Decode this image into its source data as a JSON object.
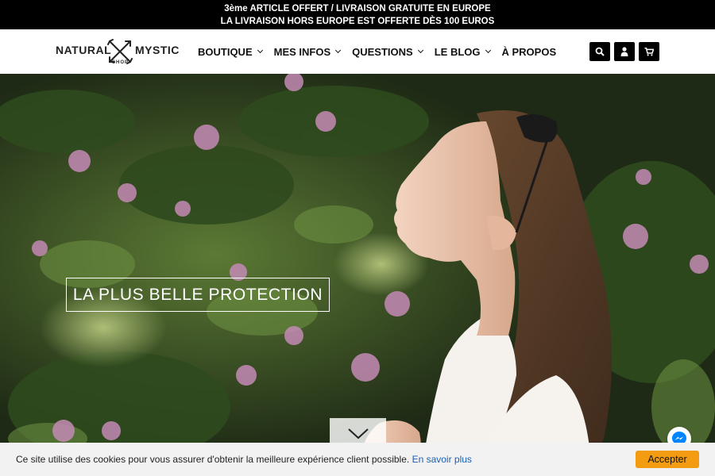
{
  "announcement": {
    "line1": "3ème ARTICLE OFFERT / LIVRAISON GRATUITE EN EUROPE",
    "line2": "LA LIVRAISON HORS EUROPE EST OFFERTE DÈS 100 EUROS"
  },
  "logo": {
    "word1": "NATURAL",
    "word2": "MYSTIC",
    "sub": "SHOP"
  },
  "nav": {
    "items": [
      {
        "label": "BOUTIQUE",
        "has_dropdown": true
      },
      {
        "label": "MES INFOS",
        "has_dropdown": true
      },
      {
        "label": "QUESTIONS",
        "has_dropdown": true
      },
      {
        "label": "LE BLOG",
        "has_dropdown": true
      },
      {
        "label": "À PROPOS",
        "has_dropdown": false
      }
    ]
  },
  "header_icons": [
    "search-icon",
    "user-icon",
    "cart-icon"
  ],
  "hero": {
    "caption": "LA PLUS BELLE PROTECTION",
    "scroll_icon": "chevron-down-icon"
  },
  "cookie": {
    "text": "Ce site utilise des cookies pour vous assurer d'obtenir la meilleure expérience client possible.",
    "link": "En savoir plus",
    "accept": "Accepter"
  },
  "colors": {
    "topbar_bg": "#000000",
    "accept_button": "#f39c12",
    "link": "#1a5fb4",
    "messenger": "#0084ff"
  }
}
